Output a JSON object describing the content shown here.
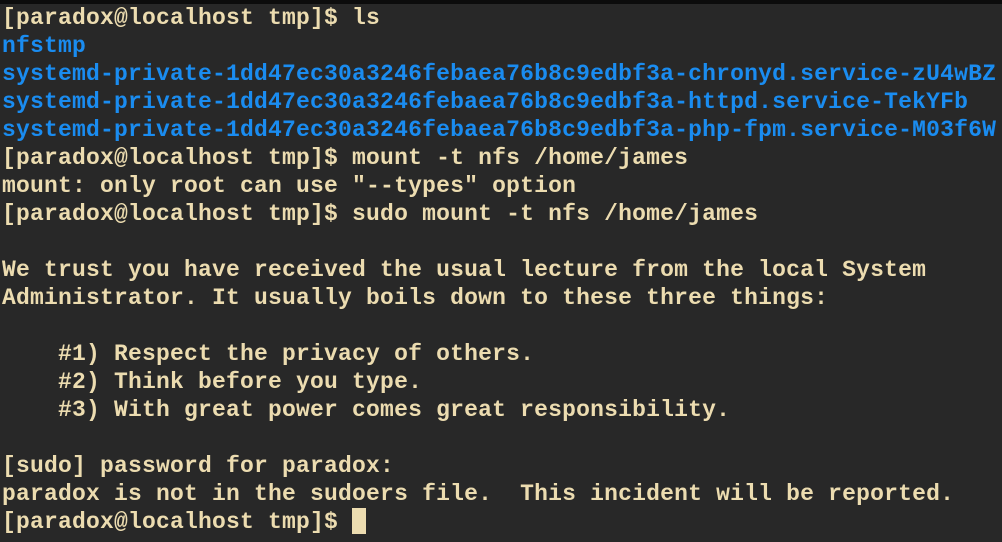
{
  "terminal": {
    "colors": {
      "background": "#282828",
      "text": "#ecdcb0",
      "directory": "#1a8cf0"
    },
    "lines": [
      {
        "text": "[paradox@localhost tmp]$ ls",
        "type": "prompt"
      },
      {
        "text": "nfstmp",
        "type": "dir"
      },
      {
        "text": "systemd-private-1dd47ec30a3246febaea76b8c9edbf3a-chronyd.service-zU4wBZ",
        "type": "dir"
      },
      {
        "text": "systemd-private-1dd47ec30a3246febaea76b8c9edbf3a-httpd.service-TekYFb",
        "type": "dir"
      },
      {
        "text": "systemd-private-1dd47ec30a3246febaea76b8c9edbf3a-php-fpm.service-M03f6W",
        "type": "dir"
      },
      {
        "text": "[paradox@localhost tmp]$ mount -t nfs /home/james",
        "type": "prompt"
      },
      {
        "text": "mount: only root can use \"--types\" option",
        "type": "output"
      },
      {
        "text": "[paradox@localhost tmp]$ sudo mount -t nfs /home/james",
        "type": "prompt"
      },
      {
        "text": "",
        "type": "output"
      },
      {
        "text": "We trust you have received the usual lecture from the local System",
        "type": "output"
      },
      {
        "text": "Administrator. It usually boils down to these three things:",
        "type": "output"
      },
      {
        "text": "",
        "type": "output"
      },
      {
        "text": "    #1) Respect the privacy of others.",
        "type": "output"
      },
      {
        "text": "    #2) Think before you type.",
        "type": "output"
      },
      {
        "text": "    #3) With great power comes great responsibility.",
        "type": "output"
      },
      {
        "text": "",
        "type": "output"
      },
      {
        "text": "[sudo] password for paradox:",
        "type": "output"
      },
      {
        "text": "paradox is not in the sudoers file.  This incident will be reported.",
        "type": "output"
      }
    ],
    "current_prompt": "[paradox@localhost tmp]$"
  }
}
